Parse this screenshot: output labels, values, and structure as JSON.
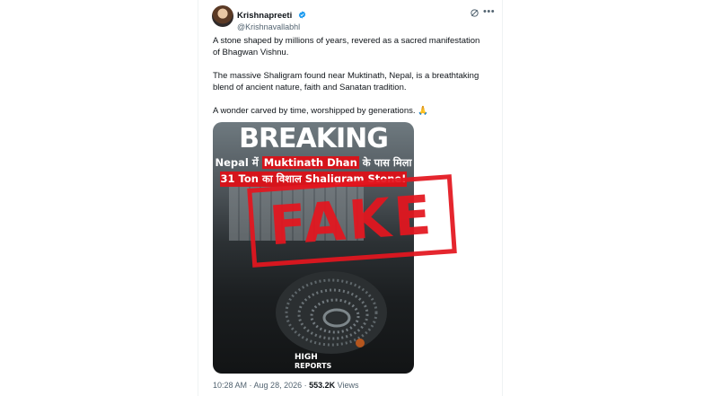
{
  "author": {
    "display_name": "Krishnapreeti",
    "handle": "@Krishnavallabhl"
  },
  "post": {
    "p1_line1": "A stone shaped by millions of years, revered as a sacred manifestation",
    "p1_line2": "of Bhagwan Vishnu.",
    "p2_line1": "The massive Shaligram found near Muktinath, Nepal, is a breathtaking",
    "p2_line2": "blend of ancient nature, faith and Sanatan tradition.",
    "p3_line1": "A wonder carved by time, worshipped by generations.",
    "emoji": "🙏"
  },
  "media": {
    "breaking": "BREAKING",
    "headline1_a": "Nepal में ",
    "headline1_highlight": "Muktinath Dhan",
    "headline1_b": " के पास मिला",
    "headline2": "31 Ton का विशाल Shaligram Stone!",
    "logo_high": "HIGH",
    "logo_reports": "REPORTS",
    "stamp": "FAKE"
  },
  "meta": {
    "time": "10:28 AM",
    "sep": " · ",
    "date": "Aug 28, 2026",
    "views_count": "553.2K",
    "views_label": " Views"
  },
  "colors": {
    "verified": "#1d9bf0",
    "stamp": "#e4161f",
    "banner": "#d6141b"
  },
  "icons": [
    "verified-badge-icon",
    "grok-icon",
    "more-icon"
  ]
}
